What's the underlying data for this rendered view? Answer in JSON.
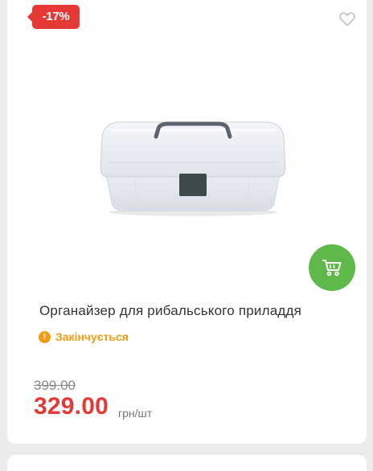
{
  "product": {
    "discount_badge": "-17%",
    "title": "Органайзер для рибальського приладдя",
    "status_text": "Закінчується",
    "old_price": "399.00",
    "price": "329.00",
    "unit": "грн/шт"
  },
  "colors": {
    "badge": "#e53935",
    "price": "#e53935",
    "cart_button": "#5fb84a",
    "status": "#f39c12"
  },
  "icons": {
    "favorite": "heart-outline-icon",
    "cart": "shopping-cart-icon",
    "status": "warning-circle-icon"
  }
}
